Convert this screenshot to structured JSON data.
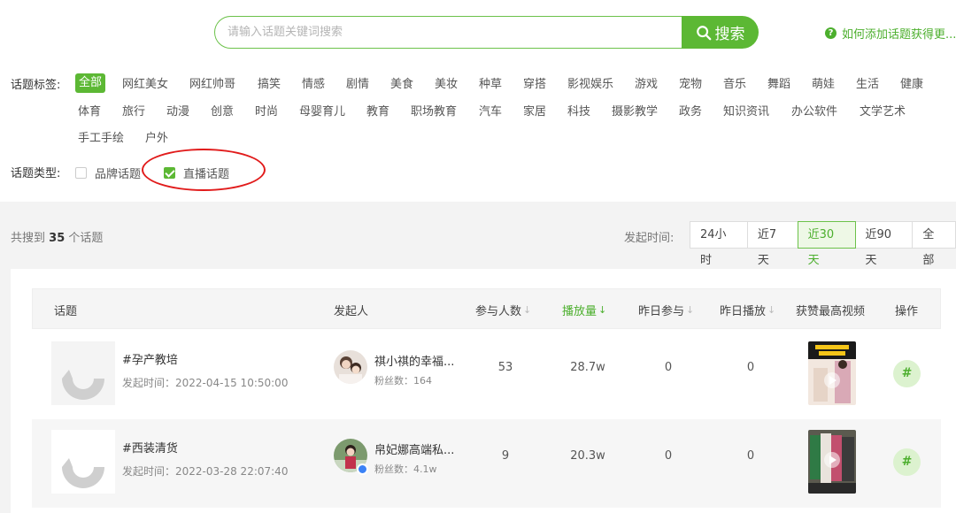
{
  "search": {
    "placeholder": "请输入话题关键词搜索",
    "button_label": "搜索"
  },
  "help_link": "如何添加话题获得更...",
  "tags": {
    "label": "话题标签:",
    "items": [
      "全部",
      "网红美女",
      "网红帅哥",
      "搞笑",
      "情感",
      "剧情",
      "美食",
      "美妆",
      "种草",
      "穿搭",
      "影视娱乐",
      "游戏",
      "宠物",
      "音乐",
      "舞蹈",
      "萌娃",
      "生活",
      "健康",
      "体育",
      "旅行",
      "动漫",
      "创意",
      "时尚",
      "母婴育儿",
      "教育",
      "职场教育",
      "汽车",
      "家居",
      "科技",
      "摄影教学",
      "政务",
      "知识资讯",
      "办公软件",
      "文学艺术",
      "手工手绘",
      "户外"
    ],
    "active": "全部"
  },
  "types": {
    "label": "话题类型:",
    "brand": "品牌话题",
    "live": "直播话题",
    "brand_checked": false,
    "live_checked": true
  },
  "results": {
    "prefix": "共搜到",
    "count": "35",
    "suffix": "个话题"
  },
  "time_filter": {
    "label": "发起时间:",
    "options": [
      "24小时",
      "近7天",
      "近30天",
      "近90天",
      "全部"
    ],
    "active": "近30天"
  },
  "table": {
    "headers": {
      "topic": "话题",
      "creator": "发起人",
      "participants": "参与人数",
      "plays": "播放量",
      "yesterday_participants": "昨日参与",
      "yesterday_plays": "昨日播放",
      "top_video": "获赞最高视频",
      "action": "操作"
    },
    "rows": [
      {
        "title": "#孕产教培",
        "time": "发起时间：2022-04-15 10:50:00",
        "creator": "祺小祺的幸福...",
        "fans": "粉丝数：164",
        "participants": "53",
        "plays": "28.7w",
        "yesterday_participants": "0",
        "yesterday_plays": "0",
        "action": "#"
      },
      {
        "title": "#西装清货",
        "time": "发起时间：2022-03-28 22:07:40",
        "creator": "帛妃娜高端私...",
        "fans": "粉丝数：4.1w",
        "participants": "9",
        "plays": "20.3w",
        "yesterday_participants": "0",
        "yesterday_plays": "0",
        "action": "#"
      }
    ]
  },
  "accent": "#5cb834"
}
